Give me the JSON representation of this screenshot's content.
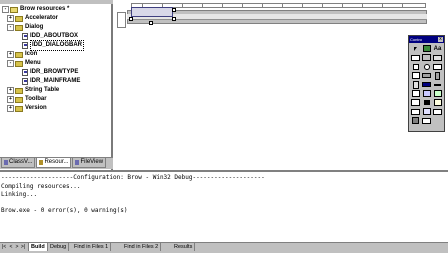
{
  "workspace": {
    "tree": [
      {
        "label": "Brow resources *",
        "level": 0,
        "icon": "folder",
        "expander": "-"
      },
      {
        "label": "Accelerator",
        "level": 1,
        "icon": "folder",
        "expander": "+"
      },
      {
        "label": "Dialog",
        "level": 1,
        "icon": "folder",
        "expander": "-"
      },
      {
        "label": "IDD_ABOUTBOX",
        "level": 2,
        "icon": "doc",
        "expander": ""
      },
      {
        "label": "IDD_DIALOGBAR",
        "level": 2,
        "icon": "doc",
        "expander": "",
        "selected": true
      },
      {
        "label": "Icon",
        "level": 1,
        "icon": "folder",
        "expander": "+"
      },
      {
        "label": "Menu",
        "level": 1,
        "icon": "folder",
        "expander": "-"
      },
      {
        "label": "IDR_BROWTYPE",
        "level": 2,
        "icon": "doc",
        "expander": ""
      },
      {
        "label": "IDR_MAINFRAME",
        "level": 2,
        "icon": "doc",
        "expander": ""
      },
      {
        "label": "String Table",
        "level": 1,
        "icon": "folder",
        "expander": "+"
      },
      {
        "label": "Toolbar",
        "level": 1,
        "icon": "folder",
        "expander": "+"
      },
      {
        "label": "Version",
        "level": 1,
        "icon": "folder",
        "expander": "+"
      }
    ],
    "tabs": [
      {
        "label": "ClassV...",
        "active": false
      },
      {
        "label": "Resour...",
        "active": true
      },
      {
        "label": "FileView",
        "active": false
      }
    ]
  },
  "controls_toolbar": {
    "title": "Contro",
    "close": "x"
  },
  "output": {
    "lines": [
      "--------------------Configuration: Brow - Win32 Debug--------------------",
      "Compiling resources...",
      "Linking...",
      "",
      "Brow.exe - 0 error(s), 0 warning(s)"
    ],
    "tabs": [
      {
        "label": "Build",
        "active": true
      },
      {
        "label": "Debug",
        "active": false
      },
      {
        "label": "Find in Files 1",
        "active": false
      },
      {
        "label": "Find in Files 2",
        "active": false
      },
      {
        "label": "Results",
        "active": false
      }
    ],
    "nav": [
      "|<",
      "<",
      ">",
      ">|"
    ]
  },
  "colors": {
    "titlebar": "#000080",
    "face": "#c0c0c0",
    "folder": "#d6c24a"
  }
}
